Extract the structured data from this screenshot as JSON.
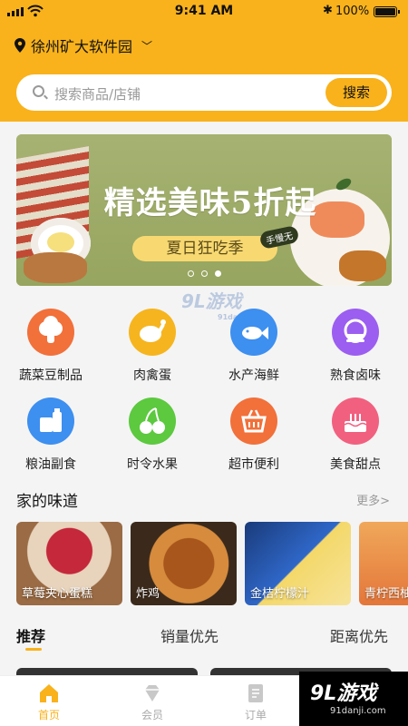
{
  "status": {
    "time": "9:41 AM",
    "battery": "100%"
  },
  "location": {
    "name": "徐州矿大软件园"
  },
  "search": {
    "placeholder": "搜索商品/店铺",
    "button": "搜索"
  },
  "banner": {
    "title": "精选美味5折起",
    "subtitle": "夏日狂吃季",
    "stamp": "手慢无",
    "page_count": 3,
    "active_page": 3
  },
  "categories": [
    {
      "label": "蔬菜豆制品",
      "icon": "vegetable-icon",
      "color": "#f2703a"
    },
    {
      "label": "肉禽蛋",
      "icon": "chicken-icon",
      "color": "#f6b51e"
    },
    {
      "label": "水产海鲜",
      "icon": "fish-icon",
      "color": "#3d8ff0"
    },
    {
      "label": "熟食卤味",
      "icon": "bowl-icon",
      "color": "#9b5ef0"
    },
    {
      "label": "粮油副食",
      "icon": "oil-icon",
      "color": "#3d8ff0"
    },
    {
      "label": "时令水果",
      "icon": "cherry-icon",
      "color": "#5cc93f"
    },
    {
      "label": "超市便利",
      "icon": "basket-icon",
      "color": "#f2703a"
    },
    {
      "label": "美食甜点",
      "icon": "cake-icon",
      "color": "#f2607f"
    }
  ],
  "home_taste": {
    "title": "家的味道",
    "more": "更多>",
    "items": [
      {
        "label": "草莓夹心蛋糕"
      },
      {
        "label": "炸鸡"
      },
      {
        "label": "金桔柠檬汁"
      },
      {
        "label": "青柠西柚"
      }
    ]
  },
  "tabs": [
    {
      "label": "推荐",
      "active": true
    },
    {
      "label": "销量优先",
      "active": false
    },
    {
      "label": "距离优先",
      "active": false
    }
  ],
  "nav": [
    {
      "label": "首页",
      "icon": "home-icon",
      "active": true
    },
    {
      "label": "会员",
      "icon": "diamond-icon",
      "active": false
    },
    {
      "label": "订单",
      "icon": "order-icon",
      "active": false
    }
  ],
  "watermark": {
    "logo": "9L游戏",
    "site": "91danji.com",
    "sub": "91danji.com"
  }
}
